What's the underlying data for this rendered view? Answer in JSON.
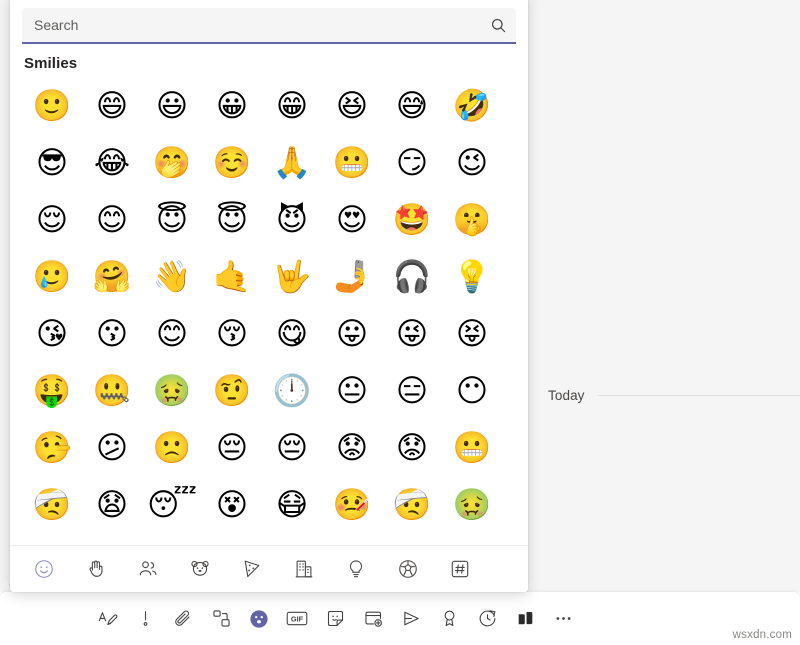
{
  "conversation": {
    "day_divider_label": "Today"
  },
  "watermark": {
    "text": "wsxdn.com"
  },
  "emoji_picker": {
    "search": {
      "placeholder": "Search",
      "value": "",
      "icon": "search-icon"
    },
    "category_heading": "Smilies",
    "accent_color": "#6264a7",
    "selected_tab_color": "#8b8cc7",
    "grid_columns": 8,
    "emojis": [
      {
        "char": "🙂",
        "name": "slightly-smiling-face"
      },
      {
        "char": "😄",
        "name": "grinning-face-with-smiling-eyes"
      },
      {
        "char": "😃",
        "name": "grinning-face-with-big-eyes"
      },
      {
        "char": "😀",
        "name": "grinning-face"
      },
      {
        "char": "😁",
        "name": "beaming-face-with-smiling-eyes"
      },
      {
        "char": "😆",
        "name": "grinning-squinting-face"
      },
      {
        "char": "😅",
        "name": "grinning-face-with-sweat"
      },
      {
        "char": "🤣",
        "name": "rolling-on-the-floor-laughing"
      },
      {
        "char": "😎",
        "name": "smirking-grin-face"
      },
      {
        "char": "😂",
        "name": "face-with-tears-of-joy"
      },
      {
        "char": "🤭",
        "name": "face-with-hand-over-mouth"
      },
      {
        "char": "☺️",
        "name": "smiling-face"
      },
      {
        "char": "🙏",
        "name": "simple-smiling-face"
      },
      {
        "char": "😬",
        "name": "grimacing-face"
      },
      {
        "char": "😏",
        "name": "smirking-face"
      },
      {
        "char": "😉",
        "name": "winking-face"
      },
      {
        "char": "😌",
        "name": "relieved-face"
      },
      {
        "char": "😊",
        "name": "smiling-face-with-smiling-eyes"
      },
      {
        "char": "😇",
        "name": "blushing-smiling-face"
      },
      {
        "char": "😇",
        "name": "smiling-face-with-halo"
      },
      {
        "char": "😈",
        "name": "smiling-face-with-horns"
      },
      {
        "char": "😍",
        "name": "smiling-face-with-heart-eyes"
      },
      {
        "char": "🤩",
        "name": "star-struck"
      },
      {
        "char": "🤫",
        "name": "shushing-face"
      },
      {
        "char": "🥲",
        "name": "face-with-tear"
      },
      {
        "char": "🤗",
        "name": "hugging-face"
      },
      {
        "char": "👋",
        "name": "waving-smiling-face"
      },
      {
        "char": "🤙",
        "name": "call-me-smiling-face"
      },
      {
        "char": "🤟",
        "name": "love-you-gesture-face"
      },
      {
        "char": "🤳",
        "name": "selfie-face"
      },
      {
        "char": "🎧",
        "name": "face-with-headphones"
      },
      {
        "char": "💡",
        "name": "idea-face"
      },
      {
        "char": "😘",
        "name": "face-blowing-a-kiss"
      },
      {
        "char": "😗",
        "name": "kissing-face"
      },
      {
        "char": "😊",
        "name": "kissing-smiling-face"
      },
      {
        "char": "😚",
        "name": "kissing-face-with-closed-eyes"
      },
      {
        "char": "😋",
        "name": "face-savoring-food"
      },
      {
        "char": "😛",
        "name": "face-with-tongue"
      },
      {
        "char": "😜",
        "name": "winking-face-with-tongue"
      },
      {
        "char": "😝",
        "name": "squinting-face-with-tongue"
      },
      {
        "char": "🤑",
        "name": "money-mouth-face"
      },
      {
        "char": "🤐",
        "name": "zipper-mouth-face"
      },
      {
        "char": "🤢",
        "name": "nauseated-green-face"
      },
      {
        "char": "🤨",
        "name": "face-with-raised-eyebrow"
      },
      {
        "char": "🕛",
        "name": "face-with-clock"
      },
      {
        "char": "😐",
        "name": "neutral-face"
      },
      {
        "char": "😑",
        "name": "expressionless-face"
      },
      {
        "char": "😶",
        "name": "face-without-mouth"
      },
      {
        "char": "🤥",
        "name": "lying-face"
      },
      {
        "char": "😕",
        "name": "confused-face"
      },
      {
        "char": "🙁",
        "name": "slightly-frowning-face"
      },
      {
        "char": "😔",
        "name": "pensive-face"
      },
      {
        "char": "😔",
        "name": "pensive-face-with-dark-hair"
      },
      {
        "char": "😟",
        "name": "worried-face"
      },
      {
        "char": "😟",
        "name": "anguished-worried-face"
      },
      {
        "char": "😬",
        "name": "grimacing-face-with-braces"
      },
      {
        "char": "🤕",
        "name": "face-with-thermometer-mouth"
      },
      {
        "char": "😧",
        "name": "anguished-face"
      },
      {
        "char": "😴",
        "name": "sleeping-face"
      },
      {
        "char": "😵",
        "name": "dizzy-knocked-out-face"
      },
      {
        "char": "😷",
        "name": "face-with-medical-mask"
      },
      {
        "char": "🤒",
        "name": "face-with-thermometer"
      },
      {
        "char": "🤕",
        "name": "face-with-head-bandage"
      },
      {
        "char": "🤢",
        "name": "nauseated-face"
      }
    ],
    "tabs": [
      {
        "name": "tab-smilies",
        "label": "Smilies",
        "icon": "smiley-icon",
        "selected": true
      },
      {
        "name": "tab-hands",
        "label": "Hands",
        "icon": "hand-icon",
        "selected": false
      },
      {
        "name": "tab-people",
        "label": "People",
        "icon": "people-icon",
        "selected": false
      },
      {
        "name": "tab-animals",
        "label": "Animals",
        "icon": "bear-icon",
        "selected": false
      },
      {
        "name": "tab-food",
        "label": "Food",
        "icon": "pizza-icon",
        "selected": false
      },
      {
        "name": "tab-travel",
        "label": "Travel",
        "icon": "building-icon",
        "selected": false
      },
      {
        "name": "tab-objects",
        "label": "Objects",
        "icon": "lightbulb-icon",
        "selected": false
      },
      {
        "name": "tab-activity",
        "label": "Activity",
        "icon": "soccer-ball-icon",
        "selected": false
      },
      {
        "name": "tab-symbols",
        "label": "Symbols",
        "icon": "hash-icon",
        "selected": false
      }
    ]
  },
  "compose_toolbar": {
    "items": [
      {
        "name": "format-button",
        "label": "Format",
        "icon": "format-text-icon",
        "active": false
      },
      {
        "name": "importance-button",
        "label": "Set delivery options",
        "icon": "exclamation-icon",
        "active": false
      },
      {
        "name": "attach-button",
        "label": "Attach",
        "icon": "paperclip-icon",
        "active": false
      },
      {
        "name": "loop-component-button",
        "label": "Loop components",
        "icon": "loop-shapes-icon",
        "active": false
      },
      {
        "name": "emoji-button",
        "label": "Emoji",
        "icon": "emoji-icon",
        "active": true
      },
      {
        "name": "giphy-button",
        "label": "Giphy",
        "icon": "gif-icon",
        "active": false
      },
      {
        "name": "sticker-button",
        "label": "Sticker",
        "icon": "sticker-icon",
        "active": false
      },
      {
        "name": "schedule-meeting-button",
        "label": "Schedule a meeting",
        "icon": "calendar-add-icon",
        "active": false
      },
      {
        "name": "stream-button",
        "label": "Stream",
        "icon": "play-arrow-icon",
        "active": false
      },
      {
        "name": "praise-button",
        "label": "Praise",
        "icon": "award-ribbon-icon",
        "active": false
      },
      {
        "name": "reminder-button",
        "label": "Reminder",
        "icon": "clock-arrow-icon",
        "active": false
      },
      {
        "name": "approvals-button",
        "label": "Approvals",
        "icon": "approvals-icon",
        "active": false
      },
      {
        "name": "more-options-button",
        "label": "More options",
        "icon": "ellipsis-icon",
        "active": false
      }
    ]
  }
}
